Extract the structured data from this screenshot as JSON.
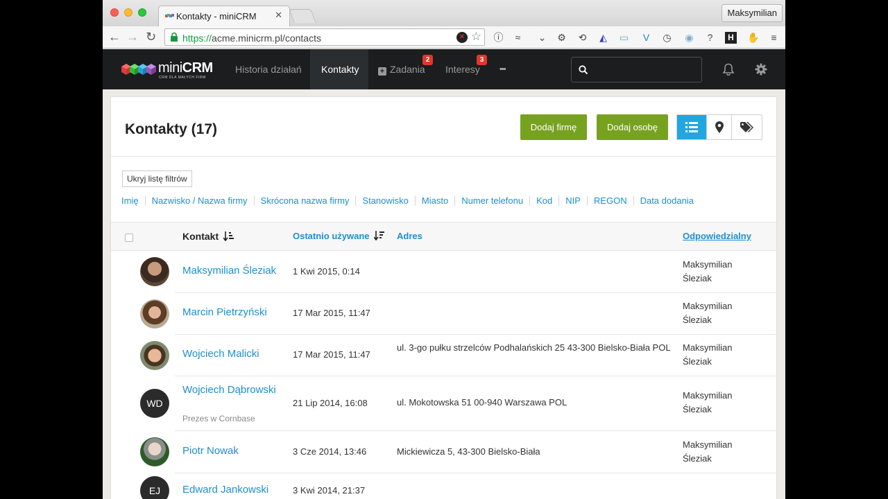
{
  "browser": {
    "tab_title": "Kontakty - miniCRM",
    "tab_close": "✕",
    "profile_name": "Maksymilian",
    "url_scheme": "https://",
    "url_rest": "acme.minicrm.pl/contacts"
  },
  "app": {
    "logo_text_light": "mini",
    "logo_text_bold": "CRM",
    "logo_tagline": "CRM DLA MAŁYCH FIRM",
    "nav": [
      {
        "label": "Historia działań"
      },
      {
        "label": "Kontakty"
      },
      {
        "label": "Zadania",
        "badge": "2"
      },
      {
        "label": "Interesy",
        "badge": "3"
      },
      {
        "label": "•••"
      }
    ],
    "search_placeholder": ""
  },
  "page": {
    "title": "Kontakty (17)",
    "add_company": "Dodaj firmę",
    "add_person": "Dodaj osobę",
    "hide_filters": "Ukryj listę filtrów",
    "filters": [
      "Imię",
      "Nazwisko / Nazwa firmy",
      "Skrócona nazwa firmy",
      "Stanowisko",
      "Miasto",
      "Numer telefonu",
      "Kod",
      "NIP",
      "REGON",
      "Data dodania"
    ]
  },
  "table": {
    "headers": {
      "contact": "Kontakt",
      "last_used": "Ostatnio używane",
      "address": "Adres",
      "owner": "Odpowiedzialny"
    },
    "rows": [
      {
        "name": "Maksymilian Śleziak",
        "date": "1 Kwi 2015, 0:14",
        "address": "",
        "owner": "Maksymilian Śleziak",
        "avatar": "photo"
      },
      {
        "name": "Marcin Pietrzyński",
        "date": "17 Mar 2015, 11:47",
        "address": "",
        "owner": "Maksymilian Śleziak",
        "avatar": "photo"
      },
      {
        "name": "Wojciech Malicki",
        "date": "17 Mar 2015, 11:47",
        "address": "ul. 3-go pułku strzelców Podhalańskich 25 43-300 Bielsko-Biała POL",
        "owner": "Maksymilian Śleziak",
        "avatar": "photo"
      },
      {
        "name": "Wojciech Dąbrowski",
        "subtitle": "Prezes w Cornbase",
        "date": "21 Lip 2014, 16:08",
        "address": "ul. Mokotowska 51 00-940 Warszawa POL",
        "owner": "Maksymilian Śleziak",
        "avatar": "WD"
      },
      {
        "name": "Piotr Nowak",
        "date": "3 Cze 2014, 13:46",
        "address": "Mickiewicza 5, 43-300 Bielsko-Biała",
        "owner": "Maksymilian Śleziak",
        "avatar": "photo"
      },
      {
        "name": "Edward Jankowski",
        "date": "3 Kwi 2014, 21:37",
        "address": "",
        "owner": "",
        "avatar": "EJ"
      }
    ]
  },
  "colors": {
    "accent_blue": "#1d8fcf",
    "green": "#77a21f",
    "active_view": "#22a6e0",
    "badge_red": "#e2362c"
  }
}
